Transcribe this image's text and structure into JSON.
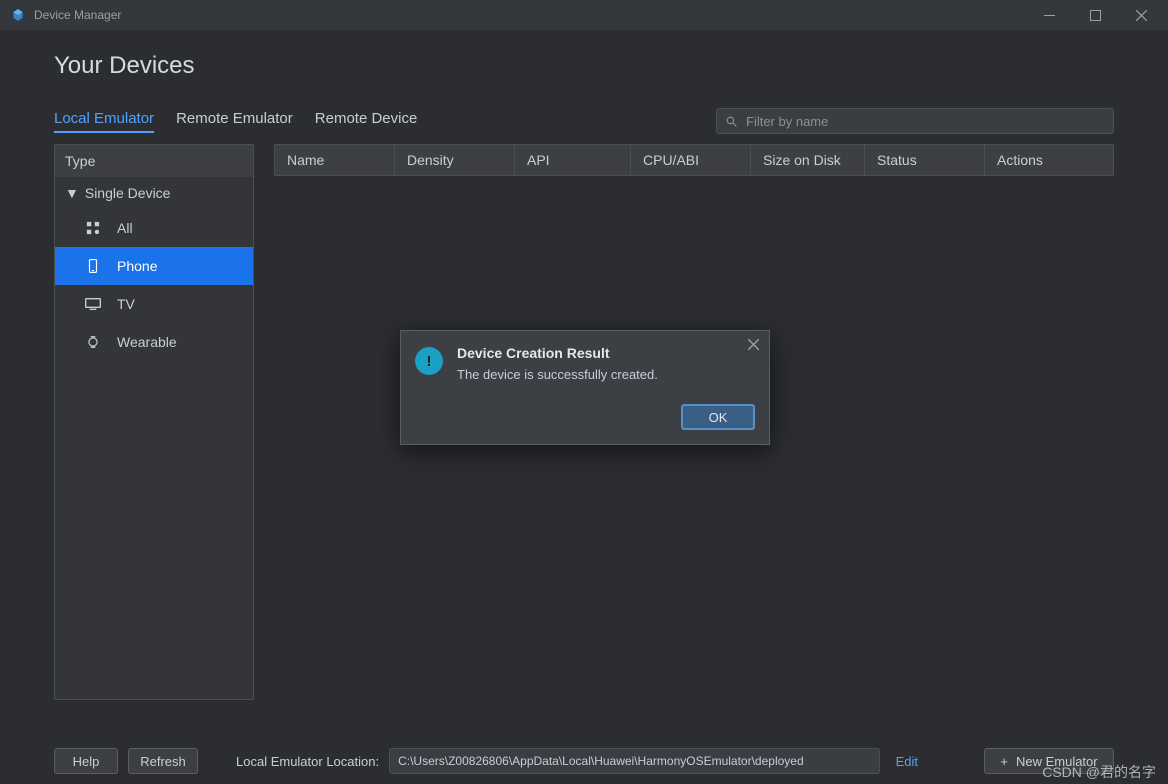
{
  "window": {
    "title": "Device Manager"
  },
  "header": {
    "title": "Your Devices"
  },
  "tabs": [
    {
      "label": "Local Emulator",
      "active": true
    },
    {
      "label": "Remote Emulator",
      "active": false
    },
    {
      "label": "Remote Device",
      "active": false
    }
  ],
  "search": {
    "placeholder": "Filter by name",
    "value": ""
  },
  "sidebar": {
    "header": "Type",
    "group": "Single Device",
    "items": [
      {
        "icon": "grid-icon",
        "label": "All",
        "selected": false
      },
      {
        "icon": "phone-icon",
        "label": "Phone",
        "selected": true
      },
      {
        "icon": "tv-icon",
        "label": "TV",
        "selected": false
      },
      {
        "icon": "watch-icon",
        "label": "Wearable",
        "selected": false
      }
    ]
  },
  "table": {
    "columns": [
      "Name",
      "Density",
      "API",
      "CPU/ABI",
      "Size on Disk",
      "Status",
      "Actions"
    ],
    "rows": []
  },
  "dialog": {
    "title": "Device Creation Result",
    "message": "The device is successfully created.",
    "ok": "OK"
  },
  "bottom": {
    "help": "Help",
    "refresh": "Refresh",
    "location_label": "Local Emulator Location:",
    "location_value": "C:\\Users\\Z00826806\\AppData\\Local\\Huawei\\HarmonyOSEmulator\\deployed",
    "edit": "Edit",
    "new_emulator": "New Emulator"
  },
  "watermark": "CSDN @君的名字"
}
